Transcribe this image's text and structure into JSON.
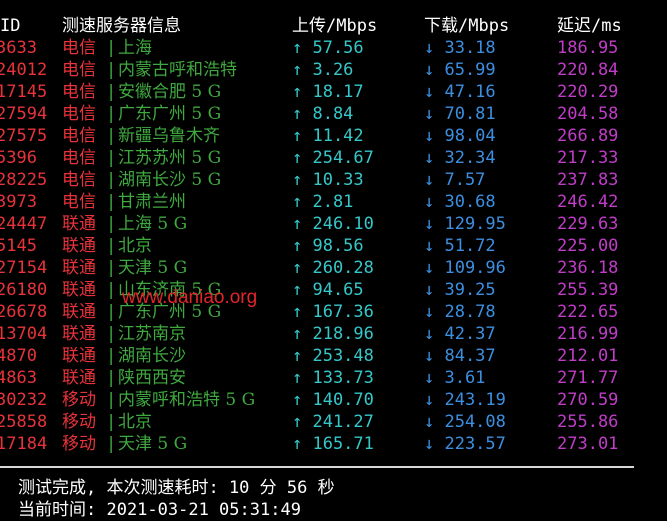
{
  "header": {
    "id": "ID",
    "name": "测速服务器信息",
    "upload": "上传/Mbps",
    "download": "下载/Mbps",
    "latency": "延迟/ms"
  },
  "rows": [
    {
      "id": "3633",
      "isp": "电信",
      "sep": "|",
      "node": "上海",
      "up": "↑ 57.56",
      "down": "↓ 33.18",
      "latency": "186.95"
    },
    {
      "id": "24012",
      "isp": "电信",
      "sep": "|",
      "node": "内蒙古呼和浩特",
      "up": "↑ 3.26",
      "down": "↓ 65.99",
      "latency": "220.84"
    },
    {
      "id": "17145",
      "isp": "电信",
      "sep": "|",
      "node": "安徽合肥 5 G",
      "up": "↑ 18.17",
      "down": "↓ 47.16",
      "latency": "220.29"
    },
    {
      "id": "27594",
      "isp": "电信",
      "sep": "|",
      "node": "广东广州 5 G",
      "up": "↑ 8.84",
      "down": "↓ 70.81",
      "latency": "204.58"
    },
    {
      "id": "27575",
      "isp": "电信",
      "sep": "|",
      "node": "新疆乌鲁木齐",
      "up": "↑ 11.42",
      "down": "↓ 98.04",
      "latency": "266.89"
    },
    {
      "id": "5396",
      "isp": "电信",
      "sep": "|",
      "node": "江苏苏州 5 G",
      "up": "↑ 254.67",
      "down": "↓ 32.34",
      "latency": "217.33"
    },
    {
      "id": "28225",
      "isp": "电信",
      "sep": "|",
      "node": "湖南长沙 5 G",
      "up": "↑ 10.33",
      "down": "↓ 7.57",
      "latency": "237.83"
    },
    {
      "id": "3973",
      "isp": "电信",
      "sep": "|",
      "node": "甘肃兰州",
      "up": "↑ 2.81",
      "down": "↓ 30.68",
      "latency": "246.42"
    },
    {
      "id": "24447",
      "isp": "联通",
      "sep": "|",
      "node": "上海 5 G",
      "up": "↑ 246.10",
      "down": "↓ 129.95",
      "latency": "229.63"
    },
    {
      "id": "5145",
      "isp": "联通",
      "sep": "|",
      "node": "北京",
      "up": "↑ 98.56",
      "down": "↓ 51.72",
      "latency": "225.00"
    },
    {
      "id": "27154",
      "isp": "联通",
      "sep": "|",
      "node": "天津 5 G",
      "up": "↑ 260.28",
      "down": "↓ 109.96",
      "latency": "236.18"
    },
    {
      "id": "26180",
      "isp": "联通",
      "sep": "|",
      "node": "山东济南 5 G",
      "up": "↑ 94.65",
      "down": "↓ 39.25",
      "latency": "255.39"
    },
    {
      "id": "26678",
      "isp": "联通",
      "sep": "|",
      "node": "广东广州 5 G",
      "up": "↑ 167.36",
      "down": "↓ 28.78",
      "latency": "222.65"
    },
    {
      "id": "13704",
      "isp": "联通",
      "sep": "|",
      "node": "江苏南京",
      "up": "↑ 218.96",
      "down": "↓ 42.37",
      "latency": "216.99"
    },
    {
      "id": "4870",
      "isp": "联通",
      "sep": "|",
      "node": "湖南长沙",
      "up": "↑ 253.48",
      "down": "↓ 84.37",
      "latency": "212.01"
    },
    {
      "id": "4863",
      "isp": "联通",
      "sep": "|",
      "node": "陕西西安",
      "up": "↑ 133.73",
      "down": "↓ 3.61",
      "latency": "271.77"
    },
    {
      "id": "30232",
      "isp": "移动",
      "sep": "|",
      "node": "内蒙呼和浩特 5 G",
      "up": "↑ 140.70",
      "down": "↓ 243.19",
      "latency": "270.59"
    },
    {
      "id": "25858",
      "isp": "移动",
      "sep": "|",
      "node": "北京",
      "up": "↑ 241.27",
      "down": "↓ 254.08",
      "latency": "255.86"
    },
    {
      "id": "17184",
      "isp": "移动",
      "sep": "|",
      "node": "天津 5 G",
      "up": "↑ 165.71",
      "down": "↓ 223.57",
      "latency": "273.01"
    }
  ],
  "watermark": "www.daniao.org",
  "footer": {
    "completed": "测试完成, 本次测速耗时: 10 分 56 秒",
    "current_time": "当前时间: 2021-03-21 05:31:49"
  },
  "colors": {
    "background": "#000000",
    "id_isp": "#e8333a",
    "node": "#3fa93f",
    "upload": "#35c7c9",
    "download": "#3c8fe0",
    "latency": "#c13cc8",
    "watermark": "#e2262a"
  }
}
